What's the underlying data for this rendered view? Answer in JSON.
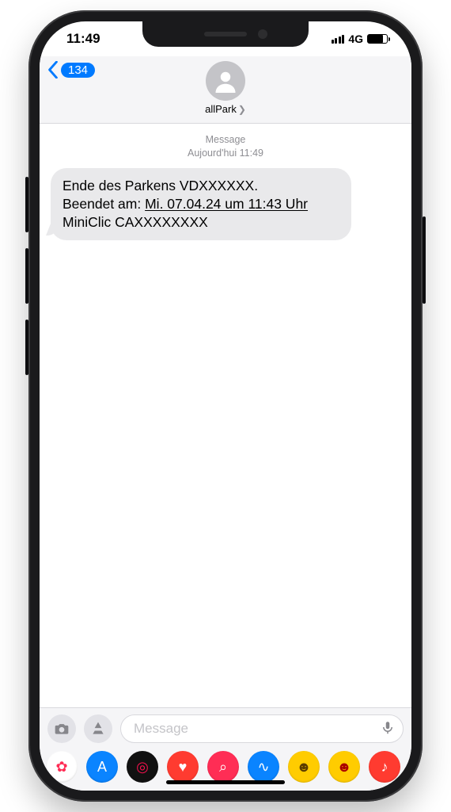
{
  "status": {
    "time": "11:49",
    "network": "4G"
  },
  "header": {
    "back_count": "134",
    "contact_name": "allPark"
  },
  "thread": {
    "meta_label": "Message",
    "meta_time": "Aujourd'hui 11:49"
  },
  "message": {
    "line1": "Ende des Parkens VDXXXXXX.",
    "line2_prefix": "Beendet am: ",
    "line2_datelink": "Mi. 07.04.24 um 11:43 Uhr",
    "line3": "MiniClic CAXXXXXXXX"
  },
  "composer": {
    "placeholder": "Message"
  },
  "app_strip": [
    {
      "name": "photos-icon",
      "bg": "#ffffff",
      "glyph": "✿",
      "fg": "#ff2d55"
    },
    {
      "name": "appstore-icon",
      "bg": "#0a84ff",
      "glyph": "A",
      "fg": "#ffffff"
    },
    {
      "name": "fitness-icon",
      "bg": "#111111",
      "glyph": "◎",
      "fg": "#fa114f"
    },
    {
      "name": "heart-icon",
      "bg": "#ff3b30",
      "glyph": "♥",
      "fg": "#ffffff"
    },
    {
      "name": "search-icon",
      "bg": "#ff2d55",
      "glyph": "⌕",
      "fg": "#ffffff"
    },
    {
      "name": "audio-icon",
      "bg": "#0a84ff",
      "glyph": "∿",
      "fg": "#ffffff"
    },
    {
      "name": "memoji1-icon",
      "bg": "#ffcc00",
      "glyph": "☻",
      "fg": "#5a3b00"
    },
    {
      "name": "memoji2-icon",
      "bg": "#ffcc00",
      "glyph": "☻",
      "fg": "#aa0000"
    },
    {
      "name": "music-icon",
      "bg": "#ff3b30",
      "glyph": "♪",
      "fg": "#ffffff"
    }
  ]
}
